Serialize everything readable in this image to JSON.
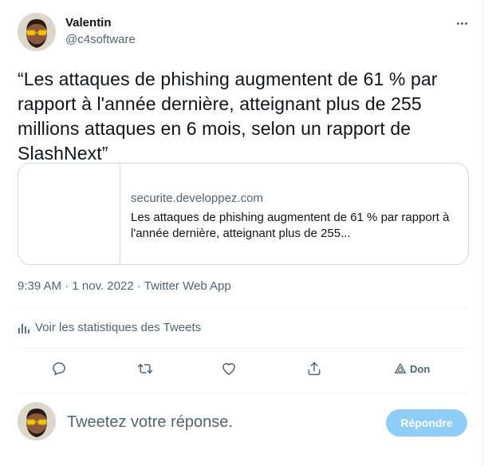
{
  "author": {
    "name": "Valentin",
    "handle": "@c4software"
  },
  "tweet": {
    "text": "“Les attaques de phishing augmentent de 61 % par rapport à l'année dernière, atteignant plus de 255 millions attaques en 6 mois, selon un rapport de SlashNext”"
  },
  "link_card": {
    "domain": "securite.developpez.com",
    "title": "Les attaques de phishing augmentent de 61 % par rapport à l'année dernière, atteignant plus de 255..."
  },
  "meta": {
    "time": "9:39 AM",
    "date": "1 nov. 2022",
    "source": "Twitter Web App",
    "separator": " · "
  },
  "stats_link": "Voir les statistiques des Tweets",
  "actions": {
    "reply_icon": "reply-icon",
    "retweet_icon": "retweet-icon",
    "like_icon": "heart-icon",
    "share_icon": "share-icon",
    "tip_icon": "tip-icon",
    "tip_label": "Don"
  },
  "reply_box": {
    "placeholder": "Tweetez votre réponse.",
    "button_label": "Répondre"
  },
  "colors": {
    "text_primary": "#0f1419",
    "text_secondary": "#536471",
    "border": "#cfd9de",
    "divider": "#eff3f4",
    "reply_button_disabled": "#8ecdf8"
  }
}
